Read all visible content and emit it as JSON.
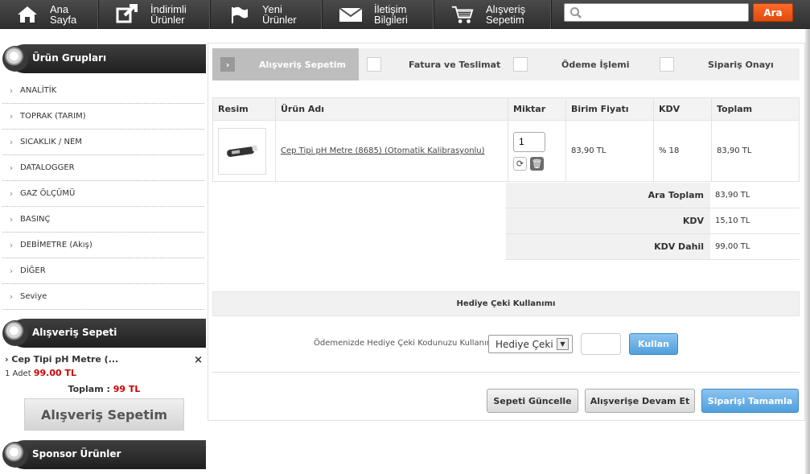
{
  "nav": {
    "items": [
      {
        "label": "Ana\nSayfa",
        "icon": "home-icon"
      },
      {
        "label": "İndirimli\nÜrünler",
        "icon": "discount-arrow-icon"
      },
      {
        "label": "Yeni\nÜrünler",
        "icon": "flag-icon"
      },
      {
        "label": "İletişim\nBilgileri",
        "icon": "mail-icon"
      },
      {
        "label": "Alışveriş\nSepetim",
        "icon": "cart-icon"
      }
    ],
    "search_placeholder": "",
    "search_button": "Ara"
  },
  "sidebar": {
    "groups_title": "Ürün Grupları",
    "categories": [
      "ANALİTİK",
      "TOPRAK (TARIM)",
      "SICAKLIK / NEM",
      "DATALOGGER",
      "GAZ ÖLÇÜMÜ",
      "BASINÇ",
      "DEBİMETRE (Akış)",
      "DİĞER",
      "Seviye"
    ],
    "cart_title": "Alışveriş Sepeti",
    "cart_item_name": "Cep Tipi pH Metre (...",
    "cart_item_remove": "×",
    "cart_item_qty": "1 Adet",
    "cart_item_price": "99.00 TL",
    "cart_total_label": "Toplam :",
    "cart_total_value": "99 TL",
    "cart_button": "Alışveriş Sepetim",
    "sponsor_title": "Sponsor Ürünler"
  },
  "steps": [
    "Alışveriş Sepetim",
    "Fatura ve Teslimat",
    "Ödeme İşlemi",
    "Sipariş Onayı"
  ],
  "table": {
    "headers": [
      "Resim",
      "Ürün Adı",
      "Miktar",
      "Birim Fiyatı",
      "KDV",
      "Toplam"
    ],
    "row": {
      "name": "Cep Tipi pH Metre (8685) (Otomatik Kalibrasyonlu)",
      "qty": "1",
      "unit_price": "83,90 TL",
      "kdv": "% 18",
      "total": "83,90 TL"
    }
  },
  "totals": [
    {
      "label": "Ara Toplam",
      "value": "83,90 TL"
    },
    {
      "label": "KDV",
      "value": "15,10 TL"
    },
    {
      "label": "KDV Dahil",
      "value": "99,00 TL"
    }
  ],
  "gift": {
    "title": "Hediye Çeki Kullanımı",
    "label": "Ödemenizde Hediye Çeki Kodunuzu Kullanın :",
    "select_value": "Hediye Çeki",
    "apply_button": "Kullan"
  },
  "actions": {
    "update": "Sepeti Güncelle",
    "continue": "Alışverişe Devam Et",
    "complete": "Siparişi Tamamla"
  }
}
